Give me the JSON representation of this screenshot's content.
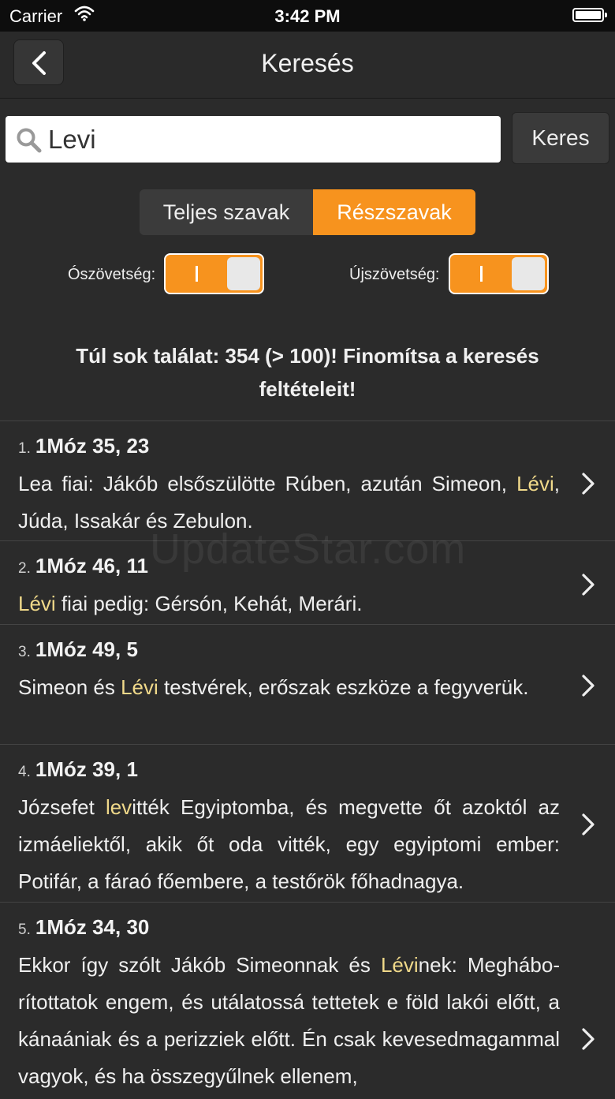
{
  "status": {
    "carrier": "Carrier",
    "time": "3:42 PM"
  },
  "nav": {
    "title": "Keresés"
  },
  "search": {
    "value": "Levi",
    "button": "Keres"
  },
  "segment": {
    "whole": "Teljes szavak",
    "partial": "Részszavak"
  },
  "toggles": {
    "old": "Ószövetség:",
    "new": "Újszövetség:",
    "on_mark": "I"
  },
  "warning": "Túl sok találat: 354 (> 100)! Finomítsa a keresés feltételeit!",
  "watermark": "UpdateStar.com",
  "results": [
    {
      "num": "1.",
      "ref": "1Móz 35, 23",
      "parts": [
        "Lea fiai: Jákób elsőszülötte Rúben, azután Simeon, ",
        "Lévi",
        ", Júda, Issakár és Zebulon."
      ]
    },
    {
      "num": "2.",
      "ref": "1Móz 46, 11",
      "parts": [
        "",
        "Lévi",
        " fiai pedig: Gérsón, Kehát, Merári."
      ]
    },
    {
      "num": "3.",
      "ref": "1Móz 49, 5",
      "parts": [
        "Simeon és ",
        "Lévi",
        " testvérek, erőszak eszköze a fegyverük."
      ]
    },
    {
      "num": "4.",
      "ref": "1Móz 39, 1",
      "parts": [
        "Józsefet ",
        "lev",
        "itték Egyiptomba, és megvette őt azoktól az izmáeliektől, akik őt oda vitték, egy egyiptomi ember: Potifár, a fáraó főembere, a testőrök főhadnagya."
      ]
    },
    {
      "num": "5.",
      "ref": "1Móz 34, 30",
      "parts": [
        "Ekkor így szólt Jákób Simeonnak és ",
        "Lévi",
        "nek: Meghábo­rítottatok engem, és utálatossá tettetek e föld lakói előtt, a kánaániak és a perizziek előtt. Én csak kevesedmagammal vagyok, és ha összegyűlnek ellenem,"
      ]
    }
  ]
}
